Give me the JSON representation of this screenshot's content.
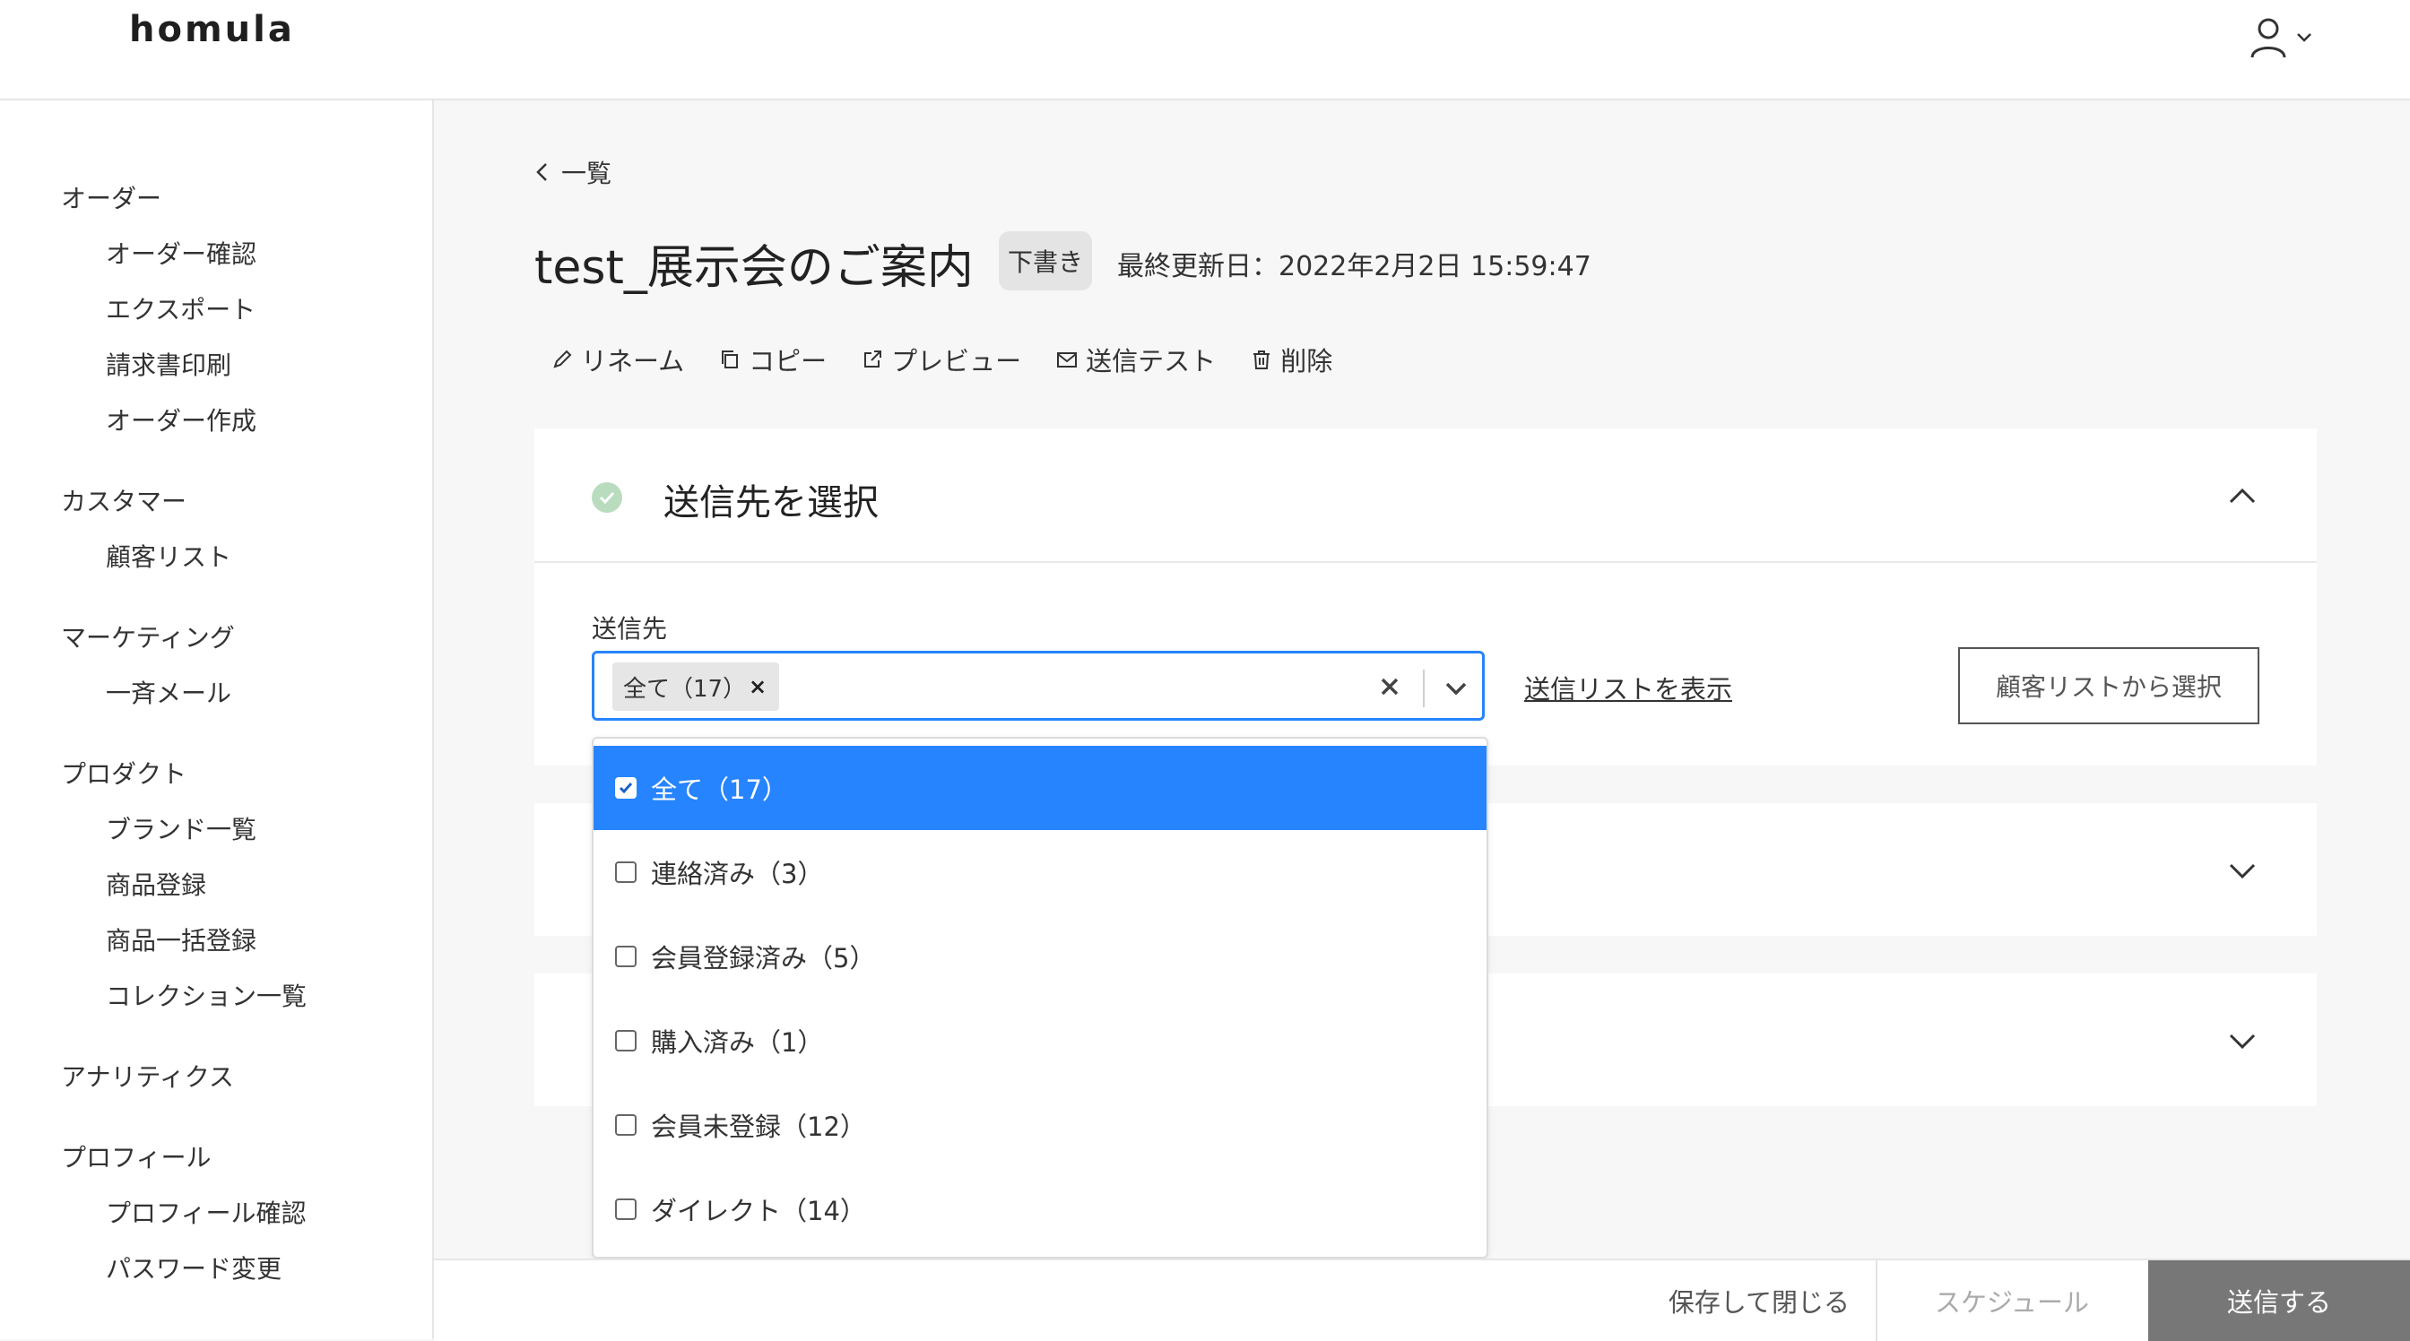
{
  "app": {
    "logo": "homula"
  },
  "sidebar": {
    "groups": [
      {
        "label": "オーダー",
        "items": [
          "オーダー確認",
          "エクスポート",
          "請求書印刷",
          "オーダー作成"
        ]
      },
      {
        "label": "カスタマー",
        "items": [
          "顧客リスト"
        ]
      },
      {
        "label": "マーケティング",
        "items": [
          "一斉メール"
        ]
      },
      {
        "label": "プロダクト",
        "items": [
          "ブランド一覧",
          "商品登録",
          "商品一括登録",
          "コレクション一覧"
        ]
      },
      {
        "label": "アナリティクス",
        "items": []
      },
      {
        "label": "プロフィール",
        "items": [
          "プロフィール確認",
          "パスワード変更"
        ]
      }
    ]
  },
  "page": {
    "back_label": "一覧",
    "title": "test_展示会のご案内",
    "status_badge": "下書き",
    "last_updated": "最終更新日：2022年2月2日 15:59:47",
    "actions": {
      "rename": "リネーム",
      "copy": "コピー",
      "preview": "プレビュー",
      "send_test": "送信テスト",
      "delete": "削除"
    }
  },
  "recipient_section": {
    "title": "送信先を選択",
    "field_label": "送信先",
    "selected_chip": "全て（17）",
    "show_list_link": "送信リストを表示",
    "select_from_customers_button": "顧客リストから選択",
    "options": [
      {
        "label": "全て（17）",
        "checked": true
      },
      {
        "label": "連絡済み（3）",
        "checked": false
      },
      {
        "label": "会員登録済み（5）",
        "checked": false
      },
      {
        "label": "購入済み（1）",
        "checked": false
      },
      {
        "label": "会員未登録（12）",
        "checked": false
      },
      {
        "label": "ダイレクト（14）",
        "checked": false
      }
    ]
  },
  "footer": {
    "save_close": "保存して閉じる",
    "schedule": "スケジュール",
    "send": "送信する"
  },
  "colors": {
    "accent": "#2684ff",
    "send_button": "#777777",
    "check_green": "#b9dcbf"
  }
}
